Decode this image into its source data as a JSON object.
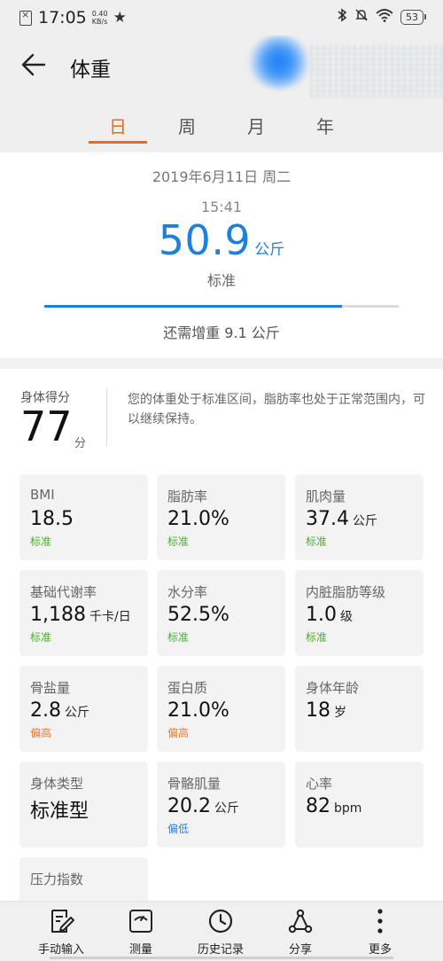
{
  "status_bar": {
    "time": "17:05",
    "speed_value": "0.40",
    "speed_unit": "KB/s",
    "battery": "53"
  },
  "header": {
    "title": "体重",
    "tabs": [
      "日",
      "周",
      "月",
      "年"
    ],
    "active_tab": 0
  },
  "summary": {
    "date": "2019年6月11日 周二",
    "time": "15:41",
    "weight": "50.9",
    "unit": "公斤",
    "status": "标准",
    "progress_fraction": 0.84,
    "hint": "还需增重 9.1 公斤"
  },
  "score": {
    "label": "身体得分",
    "value": "77",
    "unit": "分",
    "description": "您的体重处于标准区间，脂肪率也处于正常范围内，可以继续保持。"
  },
  "metrics": [
    {
      "label": "BMI",
      "value": "18.5",
      "unit": "",
      "status": "标准",
      "status_type": "normal"
    },
    {
      "label": "脂肪率",
      "value": "21.0%",
      "unit": "",
      "status": "标准",
      "status_type": "normal"
    },
    {
      "label": "肌肉量",
      "value": "37.4",
      "unit": "公斤",
      "status": "标准",
      "status_type": "normal"
    },
    {
      "label": "基础代谢率",
      "value": "1,188",
      "unit": "千卡/日",
      "status": "标准",
      "status_type": "normal"
    },
    {
      "label": "水分率",
      "value": "52.5%",
      "unit": "",
      "status": "标准",
      "status_type": "normal"
    },
    {
      "label": "内脏脂肪等级",
      "value": "1.0",
      "unit": "级",
      "status": "标准",
      "status_type": "normal"
    },
    {
      "label": "骨盐量",
      "value": "2.8",
      "unit": "公斤",
      "status": "偏高",
      "status_type": "high"
    },
    {
      "label": "蛋白质",
      "value": "21.0%",
      "unit": "",
      "status": "偏高",
      "status_type": "high"
    },
    {
      "label": "身体年龄",
      "value": "18",
      "unit": "岁",
      "status": "",
      "status_type": ""
    },
    {
      "label": "身体类型",
      "value": "标准型",
      "unit": "",
      "status": "",
      "status_type": ""
    },
    {
      "label": "骨骼肌量",
      "value": "20.2",
      "unit": "公斤",
      "status": "偏低",
      "status_type": "low"
    },
    {
      "label": "心率",
      "value": "82",
      "unit": "bpm",
      "status": "",
      "status_type": ""
    },
    {
      "label": "压力指数",
      "value": "",
      "unit": "",
      "status": "",
      "status_type": ""
    }
  ],
  "status_colors": {
    "normal": "#4caf2c",
    "high": "#e87a2c",
    "low": "#2d82d8"
  },
  "bottom_nav": [
    {
      "label": "手动输入",
      "icon": "edit-icon"
    },
    {
      "label": "测量",
      "icon": "scale-icon"
    },
    {
      "label": "历史记录",
      "icon": "clock-icon"
    },
    {
      "label": "分享",
      "icon": "share-icon"
    },
    {
      "label": "更多",
      "icon": "more-icon"
    }
  ]
}
